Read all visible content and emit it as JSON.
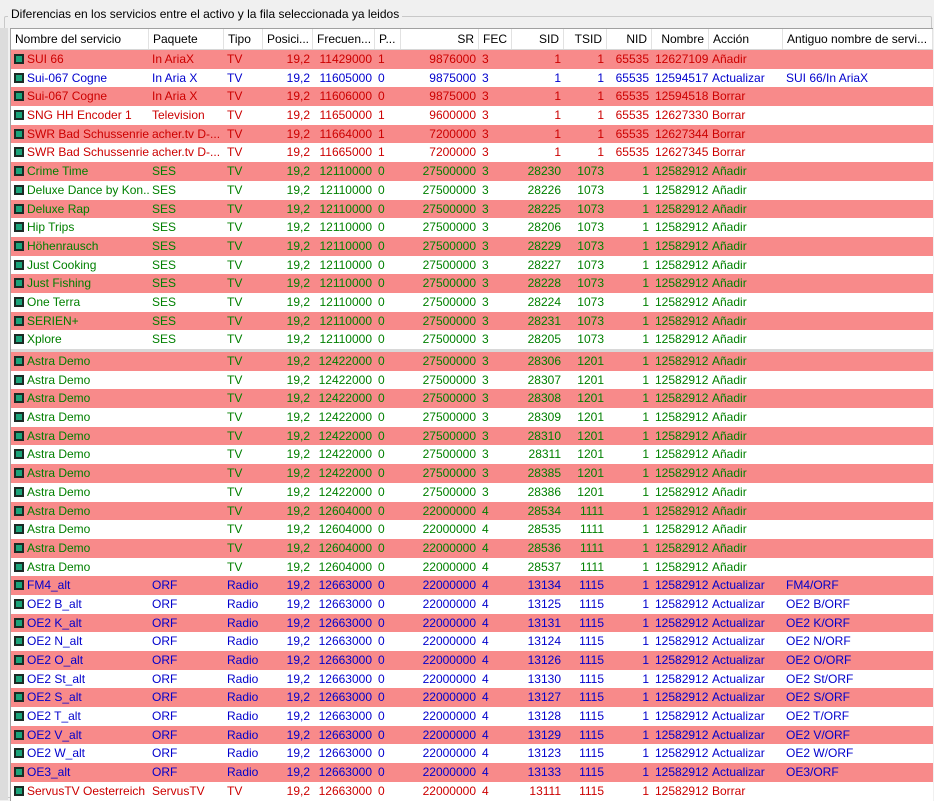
{
  "group": {
    "title": "Diferencias en los servicios entre el activo y la fila seleccionada ya leidos"
  },
  "colors": {
    "add": "#008000",
    "update": "#0000cc",
    "delete": "#cc0000",
    "row_alt": "#f88a8a"
  },
  "icons": {
    "row": "service-icon"
  },
  "columns": [
    "Nombre del servicio",
    "Paquete",
    "Tipo",
    "Posici...",
    "Frecuen...",
    "P...",
    "SR",
    "FEC",
    "SID",
    "TSID",
    "NID",
    "Nombre",
    "Acción",
    "Antiguo nombre de servi..."
  ],
  "rows": [
    {
      "kind": "del",
      "c": [
        "SUI 66",
        "In AriaX",
        "TV",
        "19,2",
        "11429000",
        "1",
        "9876000",
        "3",
        "1",
        "1",
        "65535",
        "12627109",
        "Añadir",
        ""
      ]
    },
    {
      "kind": "upd",
      "c": [
        "Sui-067 Cogne",
        "In Aria X",
        "TV",
        "19,2",
        "11605000",
        "0",
        "9875000",
        "3",
        "1",
        "1",
        "65535",
        "12594517",
        "Actualizar",
        "SUI 66/In AriaX"
      ]
    },
    {
      "kind": "del",
      "c": [
        "Sui-067 Cogne",
        "In Aria X",
        "TV",
        "19,2",
        "11606000",
        "0",
        "9875000",
        "3",
        "1",
        "1",
        "65535",
        "12594518",
        "Borrar",
        ""
      ]
    },
    {
      "kind": "del",
      "c": [
        "SNG HH Encoder 1",
        "Television",
        "TV",
        "19,2",
        "11650000",
        "1",
        "9600000",
        "3",
        "1",
        "1",
        "65535",
        "12627330",
        "Borrar",
        ""
      ]
    },
    {
      "kind": "del",
      "c": [
        "SWR Bad Schussenried",
        "acher.tv D-...",
        "TV",
        "19,2",
        "11664000",
        "1",
        "7200000",
        "3",
        "1",
        "1",
        "65535",
        "12627344",
        "Borrar",
        ""
      ]
    },
    {
      "kind": "del",
      "c": [
        "SWR Bad Schussenried",
        "acher.tv D-...",
        "TV",
        "19,2",
        "11665000",
        "1",
        "7200000",
        "3",
        "1",
        "1",
        "65535",
        "12627345",
        "Borrar",
        ""
      ]
    },
    {
      "kind": "add",
      "c": [
        "Crime Time",
        "SES",
        "TV",
        "19,2",
        "12110000",
        "0",
        "27500000",
        "3",
        "28230",
        "1073",
        "1",
        "12582912",
        "Añadir",
        ""
      ]
    },
    {
      "kind": "add",
      "c": [
        "Deluxe Dance by Kon...",
        "SES",
        "TV",
        "19,2",
        "12110000",
        "0",
        "27500000",
        "3",
        "28226",
        "1073",
        "1",
        "12582912",
        "Añadir",
        ""
      ]
    },
    {
      "kind": "add",
      "c": [
        "Deluxe Rap",
        "SES",
        "TV",
        "19,2",
        "12110000",
        "0",
        "27500000",
        "3",
        "28225",
        "1073",
        "1",
        "12582912",
        "Añadir",
        ""
      ]
    },
    {
      "kind": "add",
      "c": [
        "Hip Trips",
        "SES",
        "TV",
        "19,2",
        "12110000",
        "0",
        "27500000",
        "3",
        "28206",
        "1073",
        "1",
        "12582912",
        "Añadir",
        ""
      ]
    },
    {
      "kind": "add",
      "c": [
        "Höhenrausch",
        "SES",
        "TV",
        "19,2",
        "12110000",
        "0",
        "27500000",
        "3",
        "28229",
        "1073",
        "1",
        "12582912",
        "Añadir",
        ""
      ]
    },
    {
      "kind": "add",
      "c": [
        "Just Cooking",
        "SES",
        "TV",
        "19,2",
        "12110000",
        "0",
        "27500000",
        "3",
        "28227",
        "1073",
        "1",
        "12582912",
        "Añadir",
        ""
      ]
    },
    {
      "kind": "add",
      "c": [
        "Just Fishing",
        "SES",
        "TV",
        "19,2",
        "12110000",
        "0",
        "27500000",
        "3",
        "28228",
        "1073",
        "1",
        "12582912",
        "Añadir",
        ""
      ]
    },
    {
      "kind": "add",
      "c": [
        "One Terra",
        "SES",
        "TV",
        "19,2",
        "12110000",
        "0",
        "27500000",
        "3",
        "28224",
        "1073",
        "1",
        "12582912",
        "Añadir",
        ""
      ]
    },
    {
      "kind": "add",
      "c": [
        "SERIEN+",
        "SES",
        "TV",
        "19,2",
        "12110000",
        "0",
        "27500000",
        "3",
        "28231",
        "1073",
        "1",
        "12582912",
        "Añadir",
        ""
      ]
    },
    {
      "kind": "add",
      "c": [
        "Xplore",
        "SES",
        "TV",
        "19,2",
        "12110000",
        "0",
        "27500000",
        "3",
        "28205",
        "1073",
        "1",
        "12582912",
        "Añadir",
        ""
      ]
    },
    {
      "kind": "add",
      "c": [
        "Astra Demo",
        "",
        "TV",
        "19,2",
        "12422000",
        "0",
        "27500000",
        "3",
        "28306",
        "1201",
        "1",
        "12582912",
        "Añadir",
        ""
      ]
    },
    {
      "kind": "add",
      "c": [
        "Astra Demo",
        "",
        "TV",
        "19,2",
        "12422000",
        "0",
        "27500000",
        "3",
        "28307",
        "1201",
        "1",
        "12582912",
        "Añadir",
        ""
      ]
    },
    {
      "kind": "add",
      "c": [
        "Astra Demo",
        "",
        "TV",
        "19,2",
        "12422000",
        "0",
        "27500000",
        "3",
        "28308",
        "1201",
        "1",
        "12582912",
        "Añadir",
        ""
      ]
    },
    {
      "kind": "add",
      "c": [
        "Astra Demo",
        "",
        "TV",
        "19,2",
        "12422000",
        "0",
        "27500000",
        "3",
        "28309",
        "1201",
        "1",
        "12582912",
        "Añadir",
        ""
      ]
    },
    {
      "kind": "add",
      "c": [
        "Astra Demo",
        "",
        "TV",
        "19,2",
        "12422000",
        "0",
        "27500000",
        "3",
        "28310",
        "1201",
        "1",
        "12582912",
        "Añadir",
        ""
      ]
    },
    {
      "kind": "add",
      "c": [
        "Astra Demo",
        "",
        "TV",
        "19,2",
        "12422000",
        "0",
        "27500000",
        "3",
        "28311",
        "1201",
        "1",
        "12582912",
        "Añadir",
        ""
      ]
    },
    {
      "kind": "add",
      "c": [
        "Astra Demo",
        "",
        "TV",
        "19,2",
        "12422000",
        "0",
        "27500000",
        "3",
        "28385",
        "1201",
        "1",
        "12582912",
        "Añadir",
        ""
      ]
    },
    {
      "kind": "add",
      "c": [
        "Astra Demo",
        "",
        "TV",
        "19,2",
        "12422000",
        "0",
        "27500000",
        "3",
        "28386",
        "1201",
        "1",
        "12582912",
        "Añadir",
        ""
      ]
    },
    {
      "kind": "add",
      "c": [
        "Astra Demo",
        "",
        "TV",
        "19,2",
        "12604000",
        "0",
        "22000000",
        "4",
        "28534",
        "1111",
        "1",
        "12582912",
        "Añadir",
        ""
      ]
    },
    {
      "kind": "add",
      "c": [
        "Astra Demo",
        "",
        "TV",
        "19,2",
        "12604000",
        "0",
        "22000000",
        "4",
        "28535",
        "1111",
        "1",
        "12582912",
        "Añadir",
        ""
      ]
    },
    {
      "kind": "add",
      "c": [
        "Astra Demo",
        "",
        "TV",
        "19,2",
        "12604000",
        "0",
        "22000000",
        "4",
        "28536",
        "1111",
        "1",
        "12582912",
        "Añadir",
        ""
      ]
    },
    {
      "kind": "add",
      "c": [
        "Astra Demo",
        "",
        "TV",
        "19,2",
        "12604000",
        "0",
        "22000000",
        "4",
        "28537",
        "1111",
        "1",
        "12582912",
        "Añadir",
        ""
      ]
    },
    {
      "kind": "upd",
      "c": [
        "FM4_alt",
        "ORF",
        "Radio",
        "19,2",
        "12663000",
        "0",
        "22000000",
        "4",
        "13134",
        "1115",
        "1",
        "12582912",
        "Actualizar",
        "FM4/ORF"
      ]
    },
    {
      "kind": "upd",
      "c": [
        "OE2 B_alt",
        "ORF",
        "Radio",
        "19,2",
        "12663000",
        "0",
        "22000000",
        "4",
        "13125",
        "1115",
        "1",
        "12582912",
        "Actualizar",
        "OE2 B/ORF"
      ]
    },
    {
      "kind": "upd",
      "c": [
        "OE2 K_alt",
        "ORF",
        "Radio",
        "19,2",
        "12663000",
        "0",
        "22000000",
        "4",
        "13131",
        "1115",
        "1",
        "12582912",
        "Actualizar",
        "OE2 K/ORF"
      ]
    },
    {
      "kind": "upd",
      "c": [
        "OE2 N_alt",
        "ORF",
        "Radio",
        "19,2",
        "12663000",
        "0",
        "22000000",
        "4",
        "13124",
        "1115",
        "1",
        "12582912",
        "Actualizar",
        "OE2 N/ORF"
      ]
    },
    {
      "kind": "upd",
      "c": [
        "OE2 O_alt",
        "ORF",
        "Radio",
        "19,2",
        "12663000",
        "0",
        "22000000",
        "4",
        "13126",
        "1115",
        "1",
        "12582912",
        "Actualizar",
        "OE2 O/ORF"
      ]
    },
    {
      "kind": "upd",
      "c": [
        "OE2 St_alt",
        "ORF",
        "Radio",
        "19,2",
        "12663000",
        "0",
        "22000000",
        "4",
        "13130",
        "1115",
        "1",
        "12582912",
        "Actualizar",
        "OE2 St/ORF"
      ]
    },
    {
      "kind": "upd",
      "c": [
        "OE2 S_alt",
        "ORF",
        "Radio",
        "19,2",
        "12663000",
        "0",
        "22000000",
        "4",
        "13127",
        "1115",
        "1",
        "12582912",
        "Actualizar",
        "OE2 S/ORF"
      ]
    },
    {
      "kind": "upd",
      "c": [
        "OE2 T_alt",
        "ORF",
        "Radio",
        "19,2",
        "12663000",
        "0",
        "22000000",
        "4",
        "13128",
        "1115",
        "1",
        "12582912",
        "Actualizar",
        "OE2 T/ORF"
      ]
    },
    {
      "kind": "upd",
      "c": [
        "OE2 V_alt",
        "ORF",
        "Radio",
        "19,2",
        "12663000",
        "0",
        "22000000",
        "4",
        "13129",
        "1115",
        "1",
        "12582912",
        "Actualizar",
        "OE2 V/ORF"
      ]
    },
    {
      "kind": "upd",
      "c": [
        "OE2 W_alt",
        "ORF",
        "Radio",
        "19,2",
        "12663000",
        "0",
        "22000000",
        "4",
        "13123",
        "1115",
        "1",
        "12582912",
        "Actualizar",
        "OE2 W/ORF"
      ]
    },
    {
      "kind": "upd",
      "c": [
        "OE3_alt",
        "ORF",
        "Radio",
        "19,2",
        "12663000",
        "0",
        "22000000",
        "4",
        "13133",
        "1115",
        "1",
        "12582912",
        "Actualizar",
        "OE3/ORF"
      ]
    },
    {
      "kind": "del",
      "c": [
        "ServusTV Oesterreich",
        "ServusTV",
        "TV",
        "19,2",
        "12663000",
        "0",
        "22000000",
        "4",
        "13111",
        "1115",
        "1",
        "12582912",
        "Borrar",
        ""
      ]
    }
  ]
}
